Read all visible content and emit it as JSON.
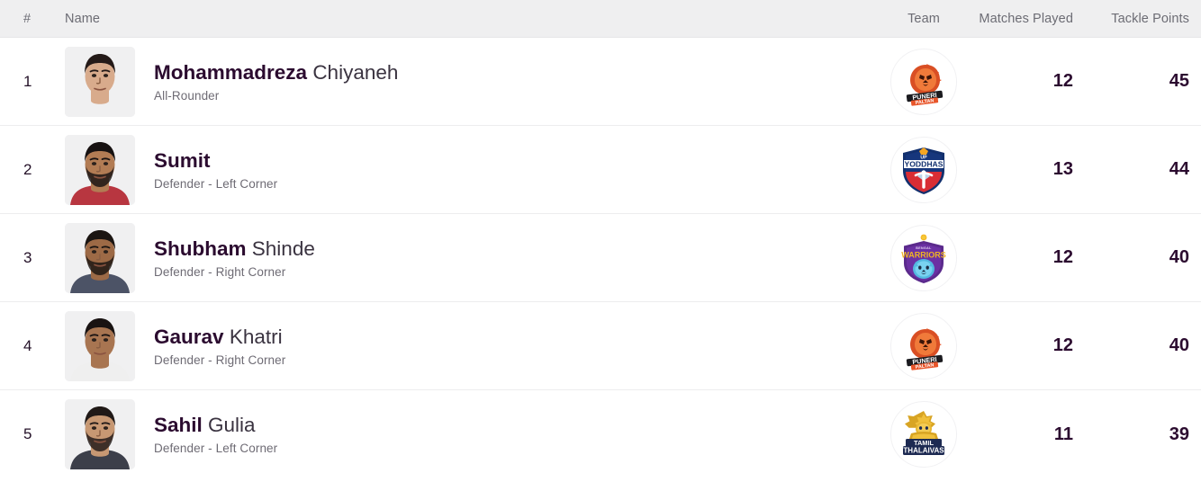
{
  "header": {
    "columns": [
      {
        "key": "rank",
        "label": "#"
      },
      {
        "key": "name",
        "label": "Name"
      },
      {
        "key": "team",
        "label": "Team"
      },
      {
        "key": "matches",
        "label": "Matches Played"
      },
      {
        "key": "points",
        "label": "Tackle Points"
      }
    ]
  },
  "colors": {
    "header_bg": "#efeff0",
    "header_text": "#6c6c74",
    "row_divider": "#ededee",
    "name_primary": "#2b0b2f",
    "name_secondary": "#3a3340",
    "role_text": "#6e6b74",
    "stat_text": "#2b0b2f",
    "avatar_bg": "#f0f0f1"
  },
  "rows": [
    {
      "rank": "1",
      "first_name": "Mohammadreza",
      "last_name": "Chiyaneh",
      "role": "All-Rounder",
      "team_name": "Puneri Paltan",
      "team_logo": "puneri-paltan-logo",
      "matches": "12",
      "points": "45"
    },
    {
      "rank": "2",
      "first_name": "Sumit",
      "last_name": "",
      "role": "Defender - Left Corner",
      "team_name": "UP Yoddhas",
      "team_logo": "up-yoddhas-logo",
      "matches": "13",
      "points": "44"
    },
    {
      "rank": "3",
      "first_name": "Shubham",
      "last_name": "Shinde",
      "role": "Defender - Right Corner",
      "team_name": "Bengal Warriors",
      "team_logo": "bengal-warriors-logo",
      "matches": "12",
      "points": "40"
    },
    {
      "rank": "4",
      "first_name": "Gaurav",
      "last_name": "Khatri",
      "role": "Defender - Right Corner",
      "team_name": "Puneri Paltan",
      "team_logo": "puneri-paltan-logo",
      "matches": "12",
      "points": "40"
    },
    {
      "rank": "5",
      "first_name": "Sahil",
      "last_name": "Gulia",
      "role": "Defender - Left Corner",
      "team_name": "Tamil Thalaivas",
      "team_logo": "tamil-thalaivas-logo",
      "matches": "11",
      "points": "39"
    }
  ]
}
